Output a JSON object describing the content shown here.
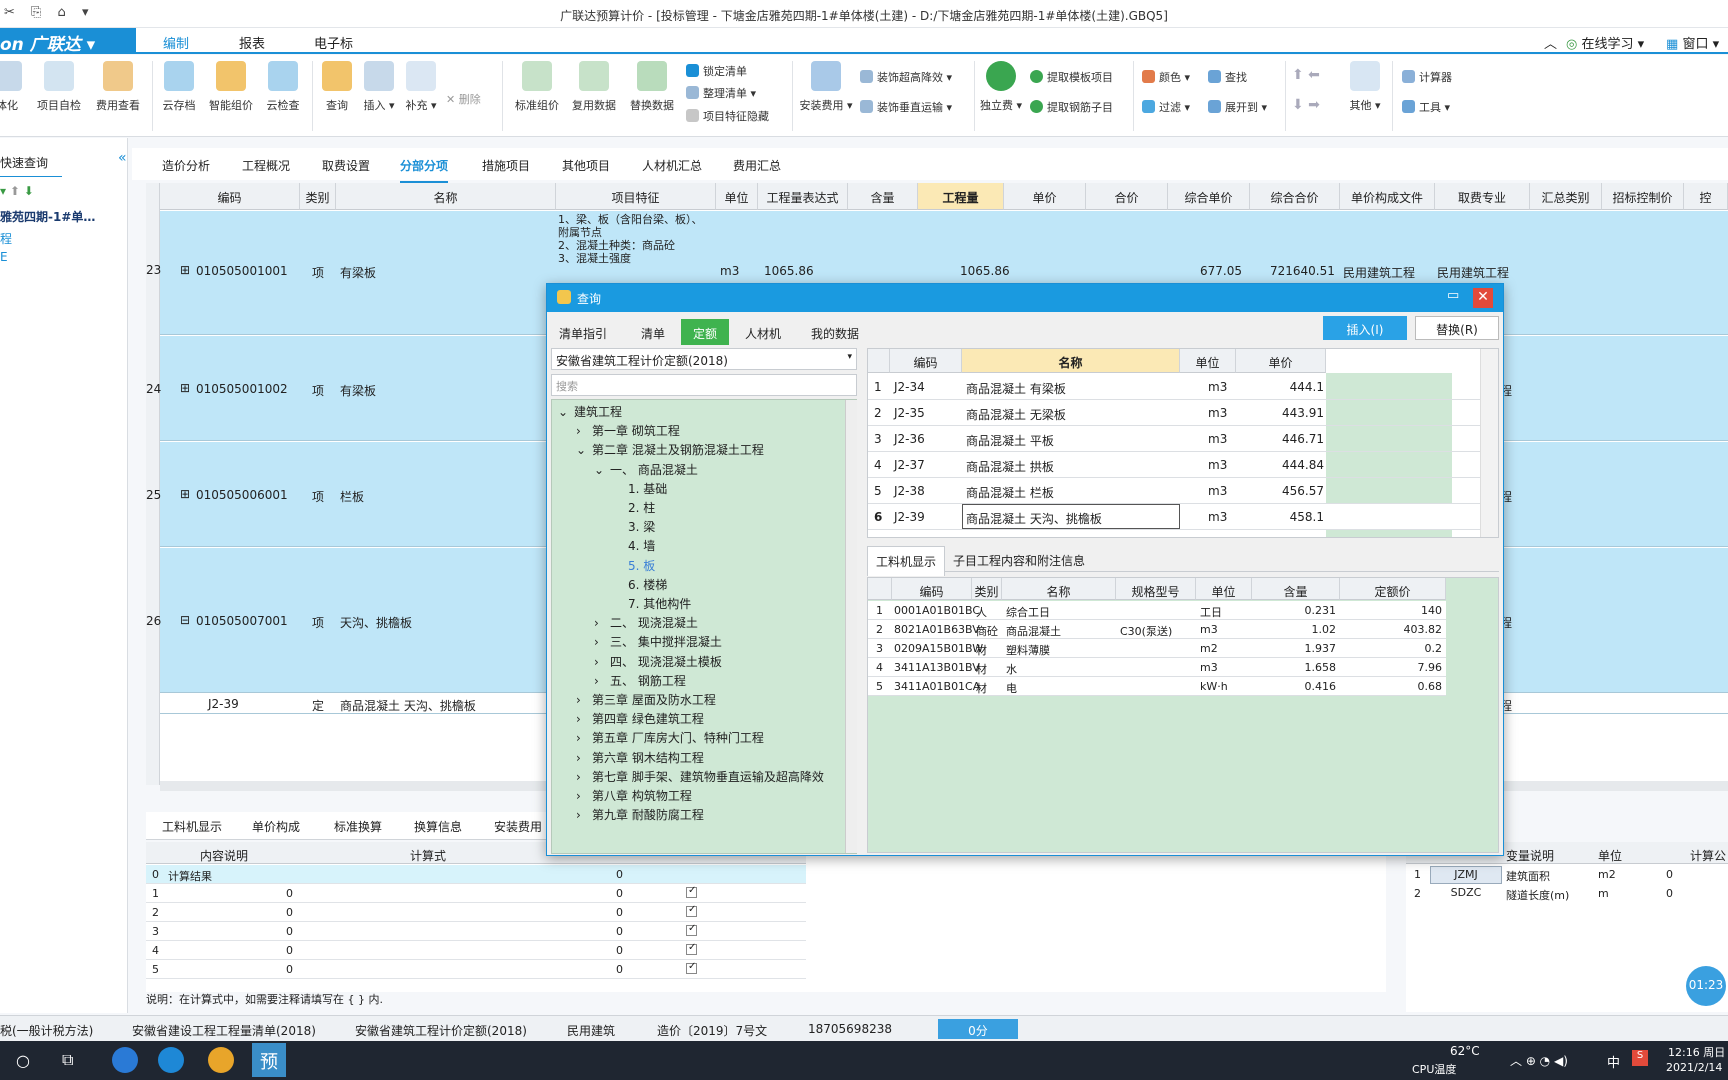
{
  "window_title": "广联达预算计价 - [投标管理 - 下塘金店雅苑四期-1#单体楼(土建) - D:/下塘金店雅苑四期-1#单体楼(土建).GBQ5]",
  "menubar": {
    "logo": "on 广联达",
    "items": [
      "编制",
      "报表",
      "电子标"
    ],
    "right": [
      "在线学习",
      "窗口"
    ]
  },
  "ribbon": {
    "big": [
      "体化",
      "项目自检",
      "费用查看",
      "云存档",
      "智能组价",
      "云检查",
      "查询",
      "插入",
      "补充",
      "标准组价",
      "复用数据",
      "替换数据",
      "安装费用",
      "独立费",
      "其他"
    ],
    "small": [
      "删除",
      "锁定清单",
      "整理清单",
      "项目特征隐藏",
      "装饰超高降效",
      "装饰垂直运输",
      "提取模板项目",
      "提取钢筋子目",
      "颜色",
      "查找",
      "过滤",
      "展开到",
      "计算器",
      "工具"
    ]
  },
  "left_pane": {
    "title": "快速查询",
    "tree_root": "雅苑四期-1#单…",
    "items": [
      "程",
      "E"
    ]
  },
  "main_tabs": [
    "造价分析",
    "工程概况",
    "取费设置",
    "分部分项",
    "措施项目",
    "其他项目",
    "人材机汇总",
    "费用汇总"
  ],
  "main_tab_active": "分部分项",
  "grid": {
    "headers": [
      "编码",
      "类别",
      "名称",
      "项目特征",
      "单位",
      "工程量表达式",
      "含量",
      "工程量",
      "单价",
      "合价",
      "综合单价",
      "综合合价",
      "单价构成文件",
      "取费专业",
      "汇总类别",
      "招标控制价",
      "控"
    ],
    "rows": [
      {
        "no": "23",
        "code": "010505001001",
        "type": "项",
        "name": "有梁板",
        "feature": "1、梁、板（含阳台梁、板）、附属节点\n2、混凝土种类：商品砼\n3、混凝土强度",
        "unit": "m3",
        "expr": "1065.86",
        "qty": "1065.86",
        "uprice": "677.05",
        "total": "721640.51",
        "file": "民用建筑工程",
        "pro": "民用建筑工程"
      },
      {
        "no": "24",
        "code": "010505001002",
        "type": "项",
        "name": "有梁板",
        "right": "程"
      },
      {
        "no": "25",
        "code": "010505006001",
        "type": "项",
        "name": "栏板",
        "right": "程"
      },
      {
        "no": "26",
        "code": "010505007001",
        "type": "项",
        "name": "天沟、挑檐板",
        "right": "程"
      },
      {
        "no": "",
        "code": "J2-39",
        "type": "定",
        "name": "商品混凝土 天沟、挑檐板",
        "right": "程"
      }
    ]
  },
  "bottom_tabs": [
    "工料机显示",
    "单价构成",
    "标准换算",
    "换算信息",
    "安装费用"
  ],
  "calc": {
    "headers": [
      "内容说明",
      "计算式"
    ],
    "rows": [
      {
        "no": "0",
        "desc": "计算结果",
        "expr": "",
        "val": "0"
      },
      {
        "no": "1",
        "desc": "",
        "expr": "0",
        "val": "0"
      },
      {
        "no": "2",
        "desc": "",
        "expr": "0",
        "val": "0"
      },
      {
        "no": "3",
        "desc": "",
        "expr": "0",
        "val": "0"
      },
      {
        "no": "4",
        "desc": "",
        "expr": "0",
        "val": "0"
      },
      {
        "no": "5",
        "desc": "",
        "expr": "0",
        "val": "0"
      }
    ],
    "note": "说明：在计算式中，如需要注释请填写在 { } 内."
  },
  "vars": {
    "headers": [
      "变量说明",
      "单位",
      "计算公"
    ],
    "rows": [
      {
        "no": "1",
        "code": "JZMJ",
        "desc": "建筑面积",
        "unit": "m2",
        "val": "0"
      },
      {
        "no": "2",
        "code": "SDZC",
        "desc": "隧道长度(m)",
        "unit": "m",
        "val": "0"
      }
    ]
  },
  "dialog": {
    "title": "查询",
    "tabs": [
      "清单指引",
      "清单",
      "定额",
      "人材机",
      "我的数据"
    ],
    "active_tab": "定额",
    "insert_btn": "插入(I)",
    "replace_btn": "替换(R)",
    "norm_select": "安徽省建筑工程计价定额(2018)",
    "search_placeholder": "搜索",
    "tree": [
      {
        "label": "建筑工程",
        "lvl": 0,
        "arrow": "⌄"
      },
      {
        "label": "第一章  砌筑工程",
        "lvl": 1,
        "arrow": "›"
      },
      {
        "label": "第二章  混凝土及钢筋混凝土工程",
        "lvl": 1,
        "arrow": "⌄"
      },
      {
        "label": "一、 商品混凝土",
        "lvl": 2,
        "arrow": "⌄"
      },
      {
        "label": "1. 基础",
        "lvl": 3,
        "arrow": ""
      },
      {
        "label": "2. 柱",
        "lvl": 3,
        "arrow": ""
      },
      {
        "label": "3. 梁",
        "lvl": 3,
        "arrow": ""
      },
      {
        "label": "4. 墙",
        "lvl": 3,
        "arrow": ""
      },
      {
        "label": "5. 板",
        "lvl": 3,
        "arrow": "",
        "sel": true
      },
      {
        "label": "6. 楼梯",
        "lvl": 3,
        "arrow": ""
      },
      {
        "label": "7. 其他构件",
        "lvl": 3,
        "arrow": ""
      },
      {
        "label": "二、 现浇混凝土",
        "lvl": 2,
        "arrow": "›"
      },
      {
        "label": "三、 集中搅拌混凝土",
        "lvl": 2,
        "arrow": "›"
      },
      {
        "label": "四、 现浇混凝土模板",
        "lvl": 2,
        "arrow": "›"
      },
      {
        "label": "五、 钢筋工程",
        "lvl": 2,
        "arrow": "›"
      },
      {
        "label": "第三章  屋面及防水工程",
        "lvl": 1,
        "arrow": "›"
      },
      {
        "label": "第四章  绿色建筑工程",
        "lvl": 1,
        "arrow": "›"
      },
      {
        "label": "第五章  厂库房大门、特种门工程",
        "lvl": 1,
        "arrow": "›"
      },
      {
        "label": "第六章  钢木结构工程",
        "lvl": 1,
        "arrow": "›"
      },
      {
        "label": "第七章  脚手架、建筑物垂直运输及超高降效",
        "lvl": 1,
        "arrow": "›"
      },
      {
        "label": "第八章  构筑物工程",
        "lvl": 1,
        "arrow": "›"
      },
      {
        "label": "第九章  耐酸防腐工程",
        "lvl": 1,
        "arrow": "›"
      }
    ],
    "quota_headers": [
      "编码",
      "名称",
      "单位",
      "单价"
    ],
    "quotas": [
      {
        "no": "1",
        "code": "J2-34",
        "name": "商品混凝土 有梁板",
        "unit": "m3",
        "price": "444.1"
      },
      {
        "no": "2",
        "code": "J2-35",
        "name": "商品混凝土 无梁板",
        "unit": "m3",
        "price": "443.91"
      },
      {
        "no": "3",
        "code": "J2-36",
        "name": "商品混凝土 平板",
        "unit": "m3",
        "price": "446.71"
      },
      {
        "no": "4",
        "code": "J2-37",
        "name": "商品混凝土 拱板",
        "unit": "m3",
        "price": "444.84"
      },
      {
        "no": "5",
        "code": "J2-38",
        "name": "商品混凝土 栏板",
        "unit": "m3",
        "price": "456.57"
      },
      {
        "no": "6",
        "code": "J2-39",
        "name": "商品混凝土 天沟、挑檐板",
        "unit": "m3",
        "price": "458.1"
      }
    ],
    "sub_tabs": [
      "工料机显示",
      "子目工程内容和附注信息"
    ],
    "res_headers": [
      "编码",
      "类别",
      "名称",
      "规格型号",
      "单位",
      "含量",
      "定额价"
    ],
    "resources": [
      {
        "no": "1",
        "code": "0001A01B01BC",
        "type": "人",
        "name": "综合工日",
        "spec": "",
        "unit": "工日",
        "amt": "0.231",
        "price": "140"
      },
      {
        "no": "2",
        "code": "8021A01B63BV",
        "type": "商砼",
        "name": "商品混凝土",
        "spec": "C30(泵送)",
        "unit": "m3",
        "amt": "1.02",
        "price": "403.82"
      },
      {
        "no": "3",
        "code": "0209A15B01BW",
        "type": "材",
        "name": "塑料薄膜",
        "spec": "",
        "unit": "m2",
        "amt": "1.937",
        "price": "0.2"
      },
      {
        "no": "4",
        "code": "3411A13B01BV",
        "type": "材",
        "name": "水",
        "spec": "",
        "unit": "m3",
        "amt": "1.658",
        "price": "7.96"
      },
      {
        "no": "5",
        "code": "3411A01B01CA",
        "type": "材",
        "name": "电",
        "spec": "",
        "unit": "kW·h",
        "amt": "0.416",
        "price": "0.68"
      }
    ]
  },
  "status": [
    "税(一般计税方法)",
    "安徽省建设工程工程量清单(2018)",
    "安徽省建筑工程计价定额(2018)",
    "民用建筑",
    "造价〔2019〕7号文",
    "18705698238",
    "0分"
  ],
  "timer": "01:23",
  "taskbar": {
    "temp": "62°C",
    "temp_label": "CPU温度",
    "ime": "中",
    "time": "12:16 周日",
    "date": "2021/2/14"
  }
}
